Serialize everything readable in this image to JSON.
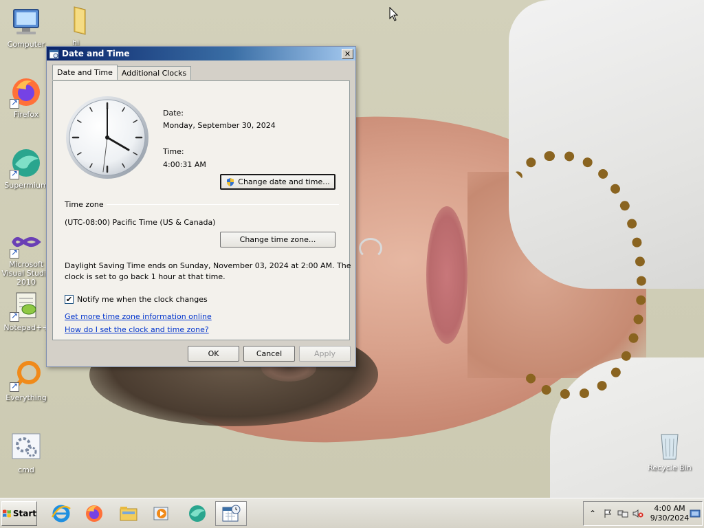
{
  "desktop": {
    "icons": [
      {
        "label": "Computer",
        "icon": "computer-icon"
      },
      {
        "label": "hi",
        "icon": "folder-icon"
      },
      {
        "label": "Firefox",
        "icon": "firefox-icon"
      },
      {
        "label": "Supermium",
        "icon": "supermium-icon"
      },
      {
        "label": "Microsoft Visual Studio 2010",
        "icon": "visual-studio-icon"
      },
      {
        "label": "Notepad++",
        "icon": "notepadpp-icon"
      },
      {
        "label": "Everything",
        "icon": "everything-icon"
      },
      {
        "label": "cmd",
        "icon": "cmd-icon"
      },
      {
        "label": "Recycle Bin",
        "icon": "recycle-bin-icon"
      }
    ]
  },
  "dialog": {
    "title": "Date and Time",
    "tabs": [
      {
        "label": "Date and Time",
        "active": true
      },
      {
        "label": "Additional Clocks",
        "active": false
      }
    ],
    "date_label": "Date:",
    "date_value": "Monday, September 30, 2024",
    "time_label": "Time:",
    "time_value": "4:00:31 AM",
    "change_datetime_button": "Change date and time...",
    "timezone_section": "Time zone",
    "timezone_value": "(UTC-08:00) Pacific Time (US & Canada)",
    "change_timezone_button": "Change time zone...",
    "dst_line1": "Daylight Saving Time ends on Sunday, November 03, 2024 at 2:00 AM. The",
    "dst_line2": "clock is set to go back 1 hour at that time.",
    "notify_checkbox_label": "Notify me when the clock changes",
    "notify_checked": true,
    "link_timezone_info": "Get more time zone information online",
    "link_how_to_set": "How do I set the clock and time zone?",
    "ok_button": "OK",
    "cancel_button": "Cancel",
    "apply_button": "Apply"
  },
  "taskbar": {
    "start_label": "Start",
    "apps": [
      "internet-explorer-icon",
      "firefox-icon",
      "file-explorer-icon",
      "media-player-icon",
      "supermium-icon",
      "date-time-control-panel-icon"
    ],
    "clock_time": "4:00 AM",
    "clock_date": "9/30/2024"
  },
  "colors": {
    "titlebar_start": "#0a246a",
    "titlebar_end": "#a6caf0",
    "link": "#0033cc",
    "dialog_face": "#d4d0c8",
    "panel_face": "#f3f1ec"
  }
}
